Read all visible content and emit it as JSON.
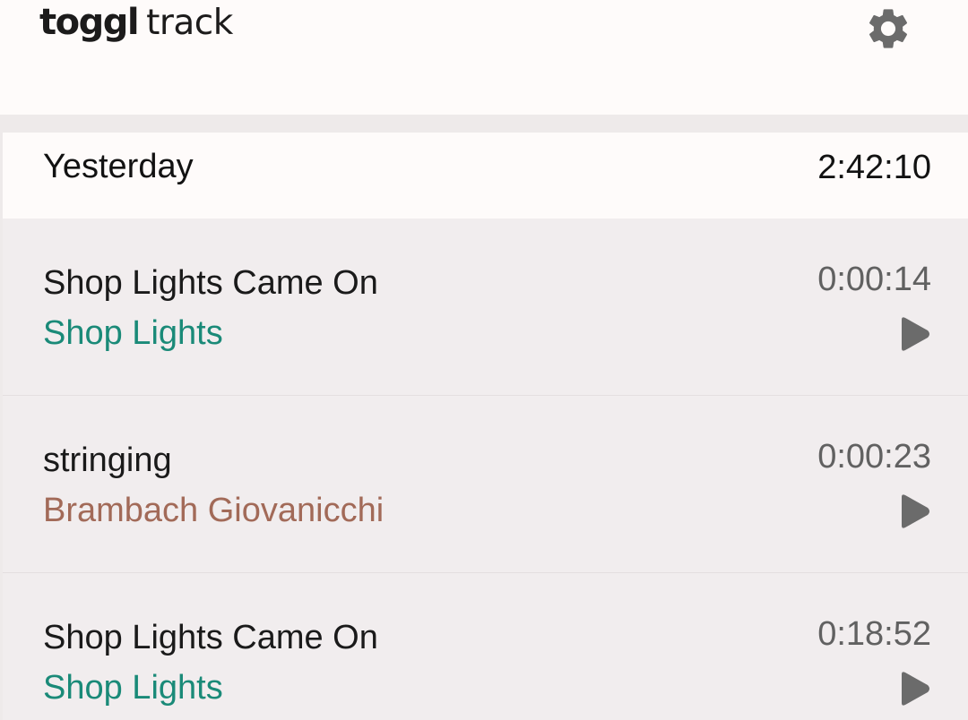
{
  "app": {
    "logo_bold": "toggl",
    "logo_light": "track"
  },
  "header": {
    "settings_icon": "gear-icon"
  },
  "group": {
    "title": "Yesterday",
    "total": "2:42:10"
  },
  "entries": [
    {
      "description": "Shop Lights Came On",
      "project": "Shop Lights",
      "project_color": "#1a8a78",
      "duration": "0:00:14",
      "action_icon": "play-icon"
    },
    {
      "description": "stringing",
      "project": "Brambach Giovanicchi",
      "project_color": "#a26a58",
      "duration": "0:00:23",
      "action_icon": "play-icon"
    },
    {
      "description": "Shop Lights Came On",
      "project": "Shop Lights",
      "project_color": "#1a8a78",
      "duration": "0:18:52",
      "action_icon": "play-icon"
    }
  ],
  "colors": {
    "header_bg": "#fefbfa",
    "list_bg": "#f1edee",
    "icon_gray": "#6b6b6b"
  }
}
